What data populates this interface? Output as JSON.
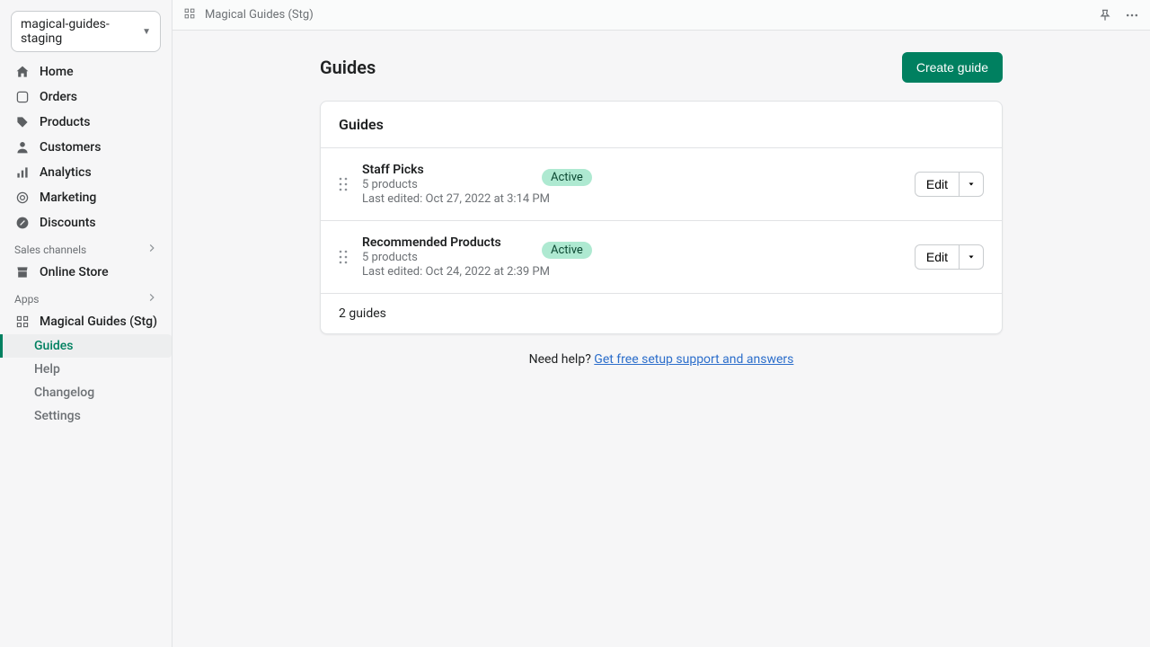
{
  "store_name": "magical-guides-staging",
  "nav": {
    "home": "Home",
    "orders": "Orders",
    "products": "Products",
    "customers": "Customers",
    "analytics": "Analytics",
    "marketing": "Marketing",
    "discounts": "Discounts"
  },
  "sections": {
    "sales_channels": "Sales channels",
    "online_store": "Online Store",
    "apps": "Apps"
  },
  "app": {
    "name": "Magical Guides (Stg)",
    "sub": {
      "guides": "Guides",
      "help": "Help",
      "changelog": "Changelog",
      "settings": "Settings"
    }
  },
  "topbar": {
    "title": "Magical Guides (Stg)"
  },
  "page": {
    "title": "Guides",
    "create_btn": "Create guide",
    "card_title": "Guides",
    "edit_label": "Edit",
    "footer": "2 guides",
    "help_prefix": "Need help? ",
    "help_link": "Get free setup support and answers"
  },
  "guides": [
    {
      "title": "Staff Picks",
      "products": "5 products",
      "status": "Active",
      "edited": "Last edited: Oct 27, 2022 at 3:14 PM"
    },
    {
      "title": "Recommended Products",
      "products": "5 products",
      "status": "Active",
      "edited": "Last edited: Oct 24, 2022 at 2:39 PM"
    }
  ]
}
